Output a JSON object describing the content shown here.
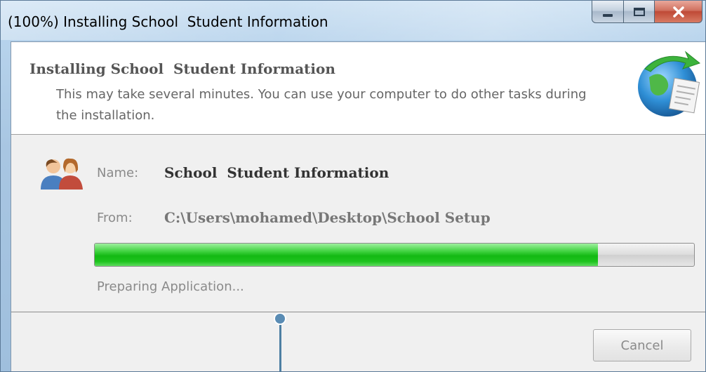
{
  "window": {
    "title": "(100%) Installing School  Student Information"
  },
  "header": {
    "title": "Installing School  Student Information",
    "description": "This may take several minutes. You can use your computer to do other tasks during the installation."
  },
  "details": {
    "name_label": "Name:",
    "name_value": "School  Student Information",
    "from_label": "From:",
    "from_value": "C:\\Users\\mohamed\\Desktop\\School Setup"
  },
  "progress": {
    "fraction": 0.84,
    "status": "Preparing Application..."
  },
  "footer": {
    "cancel_label": "Cancel"
  },
  "colors": {
    "progress_fill": "#1ec41e",
    "close_button": "#bf4a36"
  },
  "icons": {
    "setup": "setup-globe-icon",
    "users": "users-icon",
    "minimize": "minimize-icon",
    "maximize": "maximize-icon",
    "close": "close-icon"
  }
}
